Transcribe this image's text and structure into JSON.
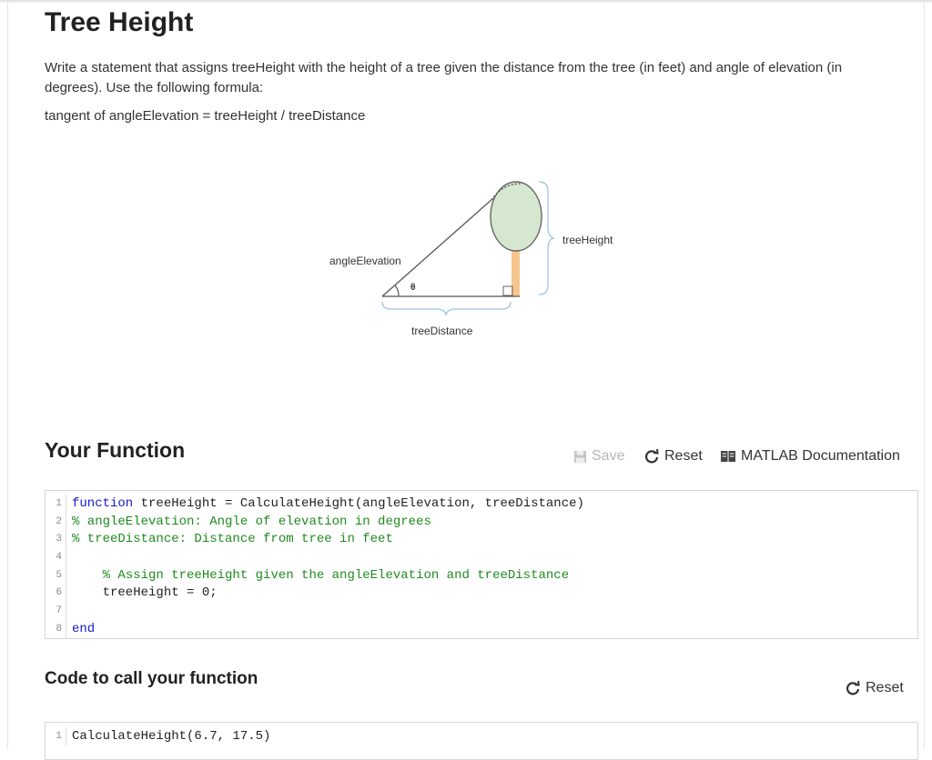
{
  "page": {
    "title": "Tree Height",
    "description": "Write a statement that assigns treeHeight with the height of a tree given the distance from the tree (in feet) and angle of elevation (in degrees). Use the following formula:",
    "formula": "tangent of angleElevation = treeHeight / treeDistance"
  },
  "diagram": {
    "angle_label": "angleElevation",
    "theta": "θ",
    "height_label": "treeHeight",
    "distance_label": "treeDistance",
    "colors": {
      "foliage": "#d5e8cf",
      "trunk": "#f7c58e",
      "brace": "#9cc3e6",
      "line": "#555555"
    }
  },
  "your_function": {
    "title": "Your Function",
    "toolbar": {
      "save_label": "Save",
      "reset_label": "Reset",
      "doc_label": "MATLAB Documentation",
      "save_icon": "floppy-disk-icon",
      "reset_icon": "refresh-icon",
      "doc_icon": "book-icon"
    },
    "code_lines": [
      {
        "num": "1",
        "parts": [
          {
            "t": "kw",
            "s": "function"
          },
          {
            "t": "tx",
            "s": " treeHeight = CalculateHeight(angleElevation, treeDistance)"
          }
        ]
      },
      {
        "num": "2",
        "parts": [
          {
            "t": "cm",
            "s": "% angleElevation: Angle of elevation in degrees"
          }
        ]
      },
      {
        "num": "3",
        "parts": [
          {
            "t": "cm",
            "s": "% treeDistance: Distance from tree in feet"
          }
        ]
      },
      {
        "num": "4",
        "parts": []
      },
      {
        "num": "5",
        "parts": [
          {
            "t": "tx",
            "s": "    "
          },
          {
            "t": "cm",
            "s": "% Assign treeHeight given the angleElevation and treeDistance"
          }
        ]
      },
      {
        "num": "6",
        "parts": [
          {
            "t": "tx",
            "s": "    treeHeight = 0;"
          }
        ]
      },
      {
        "num": "7",
        "parts": []
      },
      {
        "num": "8",
        "parts": [
          {
            "t": "kw",
            "s": "end"
          }
        ]
      }
    ]
  },
  "call_section": {
    "title": "Code to call your function",
    "reset_label": "Reset",
    "reset_icon": "refresh-icon",
    "code_lines": [
      {
        "num": "1",
        "parts": [
          {
            "t": "tx",
            "s": "CalculateHeight(6.7, 17.5)"
          }
        ]
      }
    ]
  }
}
